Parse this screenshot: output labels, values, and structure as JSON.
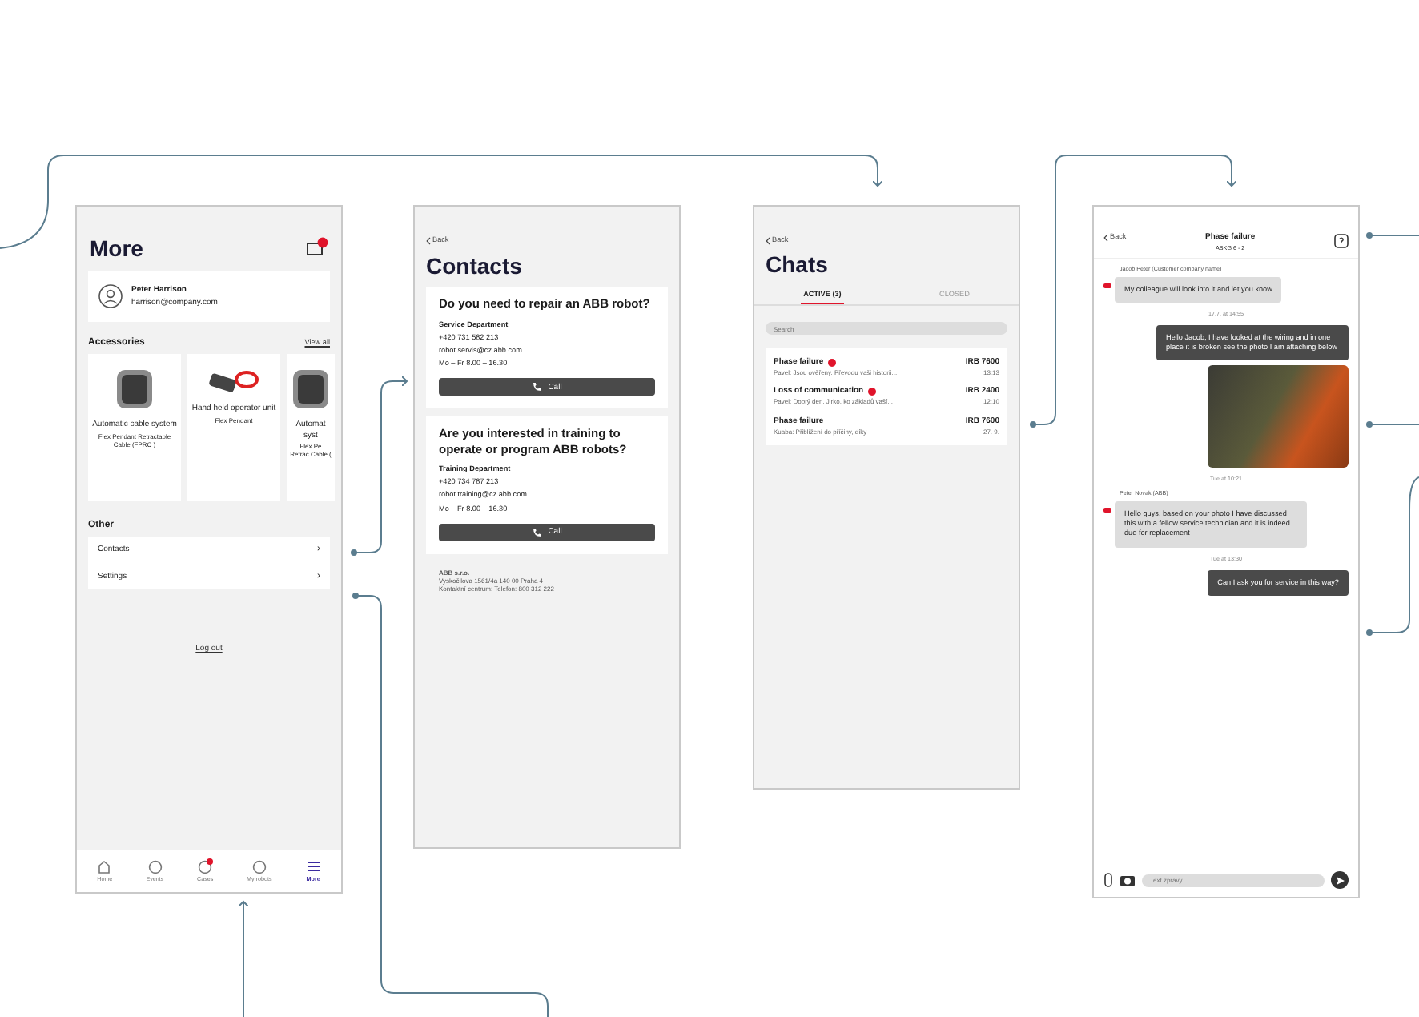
{
  "more_screen": {
    "title": "More",
    "notification": true,
    "profile": {
      "name": "Peter Harrison",
      "email": "harrison@company.com"
    },
    "accessories": {
      "heading": "Accessories",
      "link": "View all",
      "cards": [
        {
          "title": "Automatic cable system",
          "subtitle": "Flex Pendant Retractable Cable (FPRC )"
        },
        {
          "title": "Hand held operator unit",
          "subtitle": "Flex Pendant"
        },
        {
          "title": "Automat syst",
          "subtitle": "Flex Pe Retrac Cable ("
        }
      ]
    },
    "other": {
      "heading": "Other",
      "items": [
        {
          "label": "Contacts",
          "chevron": "›"
        },
        {
          "label": "Settings",
          "chevron": "›"
        }
      ]
    },
    "logout": "Log out",
    "nav": [
      {
        "label": "Home",
        "selected": false,
        "badge": false
      },
      {
        "label": "Events",
        "selected": false,
        "badge": false
      },
      {
        "label": "Cases",
        "selected": false,
        "badge": true
      },
      {
        "label": "My robots",
        "selected": false,
        "badge": false
      },
      {
        "label": "More",
        "selected": true,
        "badge": false
      }
    ]
  },
  "contacts_screen": {
    "back": "Back",
    "title": "Contacts",
    "cards": [
      {
        "heading": "Do you need to repair an ABB robot?",
        "department": "Service Department",
        "phone": "+420 731 582 213",
        "email": "robot.servis@cz.abb.com",
        "hours": "Mo – Fr 8.00 – 16.30",
        "button": "Call"
      },
      {
        "heading": "Are you interested in training to operate or program ABB robots?",
        "department": "Training Department",
        "phone": "+420 734 787 213",
        "email": "robot.training@cz.abb.com",
        "hours": "Mo – Fr 8.00 – 16.30",
        "button": "Call"
      }
    ],
    "footer": [
      "ABB s.r.o.",
      "Vyskočilova 1561/4a 140 00 Praha 4",
      "Kontaktní centrum: Telefon: 800 312 222"
    ]
  },
  "chats_screen": {
    "back": "Back",
    "title": "Chats",
    "tabs": [
      {
        "label": "ACTIVE (3)",
        "selected": true
      },
      {
        "label": "CLOSED",
        "selected": false
      }
    ],
    "search": {
      "placeholder": "Search"
    },
    "chats": [
      {
        "title": "Phase failure",
        "unread": true,
        "robot": "IRB 7600",
        "preview": "Pavel: Jsou ověřeny. Převodu vaši historii...",
        "time": "13:13"
      },
      {
        "title": "Loss of communication",
        "unread": true,
        "robot": "IRB 2400",
        "preview": "Pavel: Dobrý den, Jirko, ko základů vaší...",
        "time": "12:10"
      },
      {
        "title": "Phase failure",
        "unread": false,
        "robot": "IRB 7600",
        "preview": "Kuaba: Přiblížení do příčiny, díky",
        "time": "27. 9."
      }
    ]
  },
  "chat_screen": {
    "back": "Back",
    "title": "Phase failure",
    "subtitle": "ABKG 6 - 2",
    "messages": [
      {
        "kind": "received",
        "sender": "Jacob Peter (Customer company name)",
        "text": "My colleague will look into it and let you know"
      },
      {
        "kind": "time",
        "text": "17.7. at 14:55"
      },
      {
        "kind": "sent",
        "text": "Hello Jacob, I have looked at the wiring and in one place it is broken see the photo I am attaching below"
      },
      {
        "kind": "photo"
      },
      {
        "kind": "time",
        "text": "Tue at 10:21"
      },
      {
        "kind": "received",
        "sender": "Peter Novak (ABB)",
        "text": "Hello guys, based on your photo I have discussed this with a fellow service technician and it is indeed due for replacement"
      },
      {
        "kind": "time",
        "text": "Tue at 13:30"
      },
      {
        "kind": "sent",
        "text": "Can I ask you for service in this way?"
      }
    ],
    "input": {
      "placeholder": "Text zprávy"
    }
  }
}
